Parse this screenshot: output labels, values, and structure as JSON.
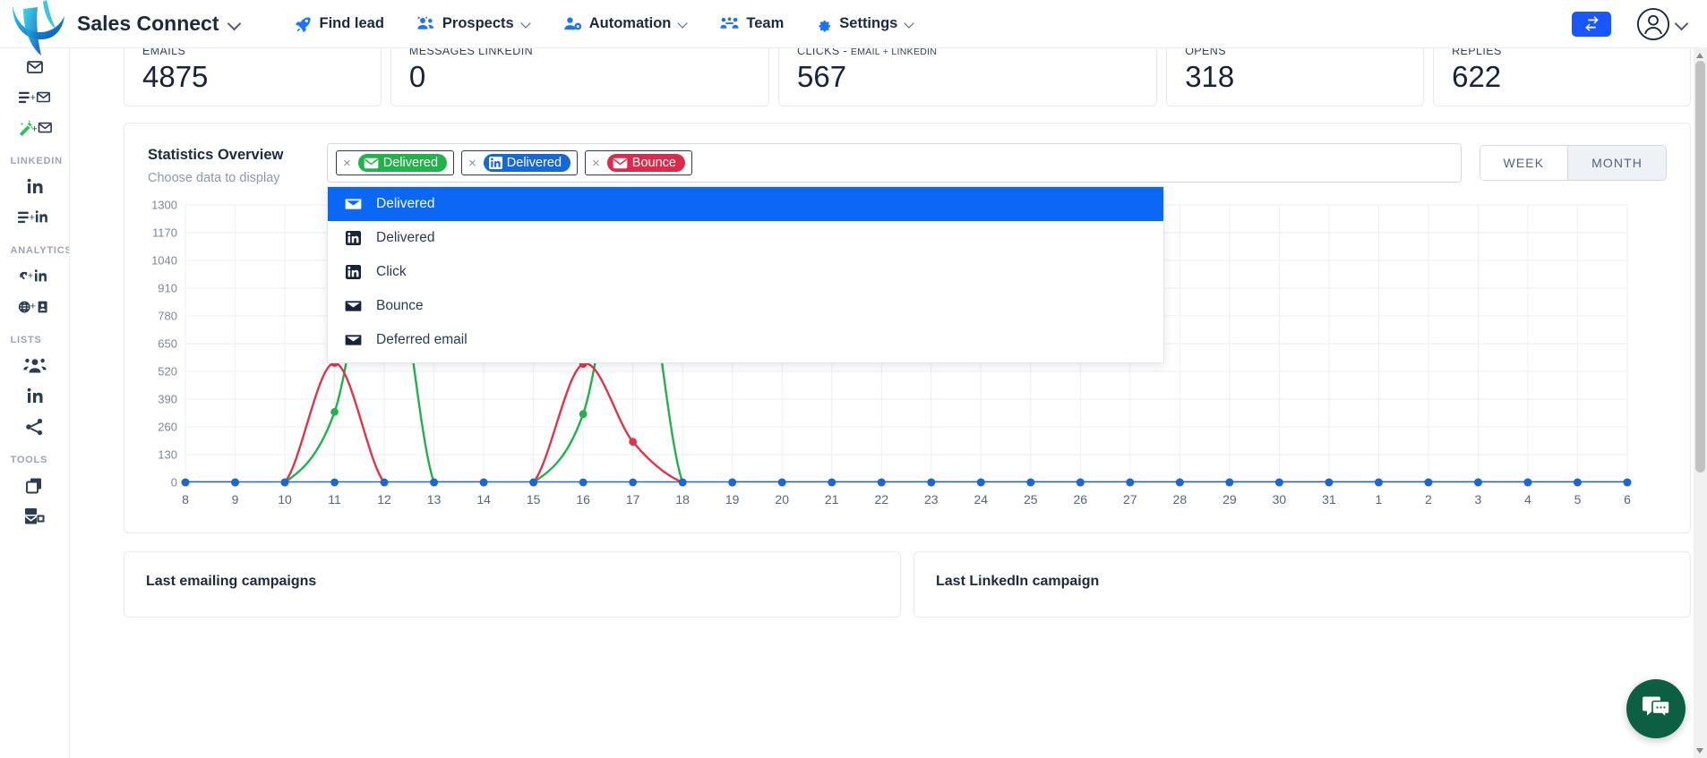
{
  "brand": {
    "name": "Sales Connect",
    "logo_icon": "sales-connect-logo"
  },
  "topnav": {
    "items": [
      {
        "label": "Find lead",
        "icon": "rocket-icon",
        "has_caret": false
      },
      {
        "label": "Prospects",
        "icon": "people-icon",
        "has_caret": true
      },
      {
        "label": "Automation",
        "icon": "person-gear-icon",
        "has_caret": true
      },
      {
        "label": "Team",
        "icon": "team-icon",
        "has_caret": false
      },
      {
        "label": "Settings",
        "icon": "gear-icon",
        "has_caret": true
      }
    ],
    "swap_icon": "swap-arrows-icon",
    "account_icon": "user-circle-icon"
  },
  "sidebar": {
    "groups": [
      {
        "label": "",
        "items": [
          {
            "icon": "envelope-open-icon",
            "name": "sidebar-item-email"
          },
          {
            "icon": "list-plus-envelope-icon",
            "name": "sidebar-item-email-campaign"
          },
          {
            "icon": "magic-wand-envelope-icon",
            "name": "sidebar-item-email-template"
          }
        ]
      },
      {
        "label": "LINKEDIN",
        "items": [
          {
            "icon": "linkedin-icon",
            "name": "sidebar-item-linkedin"
          },
          {
            "icon": "list-plus-linkedin-icon",
            "name": "sidebar-item-linkedin-campaign"
          }
        ]
      },
      {
        "label": "ANALYTICS",
        "items": [
          {
            "icon": "link-plus-linkedin-icon",
            "name": "sidebar-item-linkedin-analytics"
          },
          {
            "icon": "globe-plus-card-icon",
            "name": "sidebar-item-web-analytics"
          }
        ]
      },
      {
        "label": "LISTS",
        "items": [
          {
            "icon": "people-group-icon",
            "name": "sidebar-item-contact-lists"
          },
          {
            "icon": "linkedin-icon",
            "name": "sidebar-item-linkedin-lists"
          },
          {
            "icon": "share-nodes-icon",
            "name": "sidebar-item-shared-lists"
          }
        ]
      },
      {
        "label": "TOOLS",
        "items": [
          {
            "icon": "copy-icon",
            "name": "sidebar-item-duplicate"
          },
          {
            "icon": "mail-server-icon",
            "name": "sidebar-item-mail-server"
          }
        ]
      }
    ]
  },
  "stats": [
    {
      "label": "EMAILS",
      "sub": "",
      "value": "4875"
    },
    {
      "label": "MESSAGES LINKEDIN",
      "sub": "",
      "value": "0"
    },
    {
      "label": "CLICKS",
      "sub": "EMAIL + LINKEDIN",
      "value": "567"
    },
    {
      "label": "OPENS",
      "sub": "",
      "value": "318"
    },
    {
      "label": "REPLIES",
      "sub": "",
      "value": "622"
    }
  ],
  "statistics_panel": {
    "title": "Statistics Overview",
    "subtitle": "Choose data to display",
    "chips": [
      {
        "label": "Delivered",
        "icon": "envelope-icon",
        "color": "#22b24c",
        "remove": "×"
      },
      {
        "label": "Delivered",
        "icon": "linkedin-icon",
        "color": "#1668d8",
        "remove": "×"
      },
      {
        "label": "Bounce",
        "icon": "envelope-icon",
        "color": "#d92b4b",
        "remove": "×"
      }
    ],
    "dropdown_options": [
      {
        "label": "Delivered",
        "icon": "envelope-icon",
        "selected": true
      },
      {
        "label": "Delivered",
        "icon": "linkedin-icon",
        "selected": false
      },
      {
        "label": "Click",
        "icon": "linkedin-icon",
        "selected": false
      },
      {
        "label": "Bounce",
        "icon": "envelope-icon",
        "selected": false
      },
      {
        "label": "Deferred email",
        "icon": "envelope-icon",
        "selected": false
      }
    ],
    "range_toggle": [
      {
        "label": "WEEK",
        "selected": false
      },
      {
        "label": "MONTH",
        "selected": true
      }
    ]
  },
  "chart_data": {
    "type": "line",
    "title": "Statistics Overview",
    "xlabel": "",
    "ylabel": "",
    "ylim": [
      0,
      1300
    ],
    "yticks": [
      0,
      130,
      260,
      390,
      520,
      650,
      780,
      910,
      1040,
      1170,
      1300
    ],
    "grid": true,
    "legend_position": "none",
    "categories": [
      "8",
      "9",
      "10",
      "11",
      "12",
      "13",
      "14",
      "15",
      "16",
      "17",
      "18",
      "19",
      "20",
      "21",
      "22",
      "23",
      "24",
      "25",
      "26",
      "27",
      "28",
      "29",
      "30",
      "31",
      "1",
      "2",
      "3",
      "4",
      "5",
      "6"
    ],
    "series": [
      {
        "name": "Delivered (email)",
        "color": "#22b24c",
        "values": [
          0,
          0,
          0,
          330,
          2100,
          0,
          0,
          0,
          320,
          2050,
          0,
          0,
          0,
          0,
          0,
          0,
          0,
          0,
          0,
          0,
          0,
          0,
          0,
          0,
          0,
          0,
          0,
          0,
          0,
          0
        ]
      },
      {
        "name": "Bounce (email)",
        "color": "#e0344a",
        "values": [
          0,
          0,
          0,
          560,
          0,
          0,
          0,
          0,
          555,
          190,
          0,
          0,
          0,
          0,
          0,
          0,
          0,
          0,
          0,
          0,
          0,
          0,
          0,
          0,
          0,
          0,
          0,
          0,
          0,
          0
        ]
      },
      {
        "name": "Delivered (linkedin)",
        "color": "#1668d8",
        "values": [
          0,
          0,
          0,
          0,
          0,
          0,
          0,
          0,
          0,
          0,
          0,
          0,
          0,
          0,
          0,
          0,
          0,
          0,
          0,
          0,
          0,
          0,
          0,
          0,
          0,
          0,
          0,
          0,
          0,
          0
        ]
      }
    ]
  },
  "bottom_cards": [
    {
      "title": "Last emailing campaigns"
    },
    {
      "title": "Last LinkedIn campaign"
    }
  ],
  "chat": {
    "icon": "chat-bubble-icon"
  },
  "colors": {
    "accent": "#1a56ff",
    "green": "#22b24c",
    "red": "#d92b4b",
    "linkedin": "#1668d8",
    "dropdown_highlight": "#0a68f5"
  }
}
